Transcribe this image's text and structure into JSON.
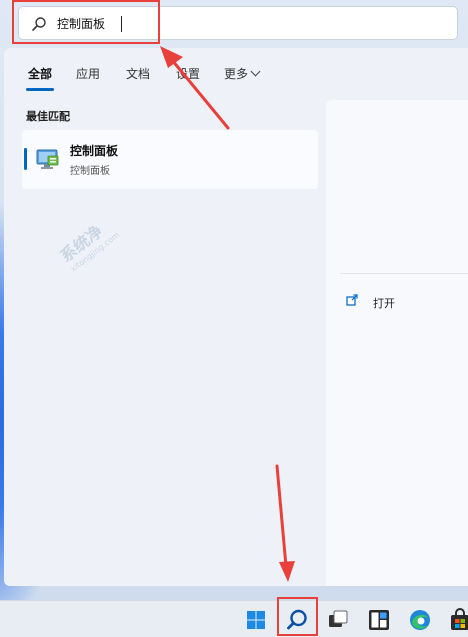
{
  "search": {
    "query": "控制面板"
  },
  "tabs": [
    "全部",
    "应用",
    "文档",
    "设置",
    "更多"
  ],
  "best_match_label": "最佳匹配",
  "result": {
    "title": "控制面板",
    "subtitle": "控制面板"
  },
  "preview": {
    "open_label": "打开"
  },
  "watermark": {
    "title": "系统净",
    "sub": "xitongjing.com"
  },
  "colors": {
    "accent": "#0067c0",
    "highlight": "#e8403a"
  },
  "taskbar": {
    "items": [
      "start-icon",
      "search-icon",
      "task-view-icon",
      "widgets-icon",
      "edge-icon",
      "store-icon"
    ]
  }
}
